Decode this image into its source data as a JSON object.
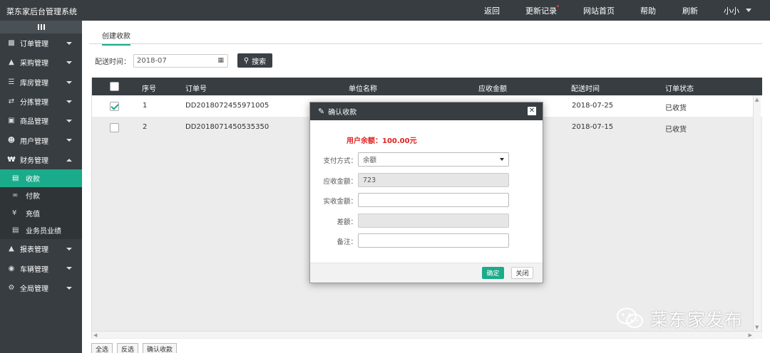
{
  "app": {
    "title": "菜东家后台管理系统"
  },
  "topnav": {
    "back": "返回",
    "updates": "更新记录",
    "homepage": "网站首页",
    "help": "帮助",
    "refresh": "刷新",
    "user": "小小"
  },
  "sidebar": {
    "items": [
      {
        "label": "订单管理",
        "icon": "order-icon"
      },
      {
        "label": "采购管理",
        "icon": "cart-icon"
      },
      {
        "label": "库房管理",
        "icon": "warehouse-icon"
      },
      {
        "label": "分拣管理",
        "icon": "shuffle-icon"
      },
      {
        "label": "商品管理",
        "icon": "goods-icon"
      },
      {
        "label": "用户管理",
        "icon": "user-icon"
      },
      {
        "label": "财务管理",
        "icon": "currency-icon"
      }
    ],
    "finance_sub": [
      {
        "label": "收款",
        "icon": "money-icon"
      },
      {
        "label": "付款",
        "icon": "link-icon"
      },
      {
        "label": "充值",
        "icon": "yen-icon"
      },
      {
        "label": "业务员业绩",
        "icon": "document-icon"
      }
    ],
    "items_after": [
      {
        "label": "报表管理",
        "icon": "chart-icon"
      },
      {
        "label": "车辆管理",
        "icon": "car-icon"
      },
      {
        "label": "全局管理",
        "icon": "cogs-icon"
      }
    ]
  },
  "tabs": {
    "active": "创建收款"
  },
  "filter": {
    "label": "配送时间：",
    "date": "2018-07",
    "search": "搜索"
  },
  "table": {
    "headers": [
      "序号",
      "订单号",
      "单位名称",
      "应收金额",
      "配送时间",
      "订单状态"
    ],
    "rows": [
      {
        "no": "1",
        "order": "DD2018072455971005",
        "date": "2018-07-25",
        "status": "已收货",
        "checked": true
      },
      {
        "no": "2",
        "order": "DD2018071450535350",
        "date": "2018-07-15",
        "status": "已收货",
        "checked": false
      }
    ]
  },
  "bottom": {
    "select_all": "全选",
    "invert": "反选",
    "confirm": "确认收款"
  },
  "modal": {
    "title": "确认收款",
    "balance": "用户余额：100.00元",
    "pay_method_label": "支付方式：",
    "pay_method_value": "余额",
    "receivable_label": "应收金额：",
    "receivable_value": "723",
    "actual_label": "实收金额：",
    "actual_value": "",
    "diff_label": "差额：",
    "diff_value": "",
    "remark_label": "备注：",
    "remark_value": "",
    "ok": "确定",
    "close": "关闭"
  },
  "watermark": {
    "text": "菜东家发布"
  },
  "colors": {
    "accent": "#1aab8a",
    "dark": "#373d41",
    "danger": "#e02020"
  }
}
